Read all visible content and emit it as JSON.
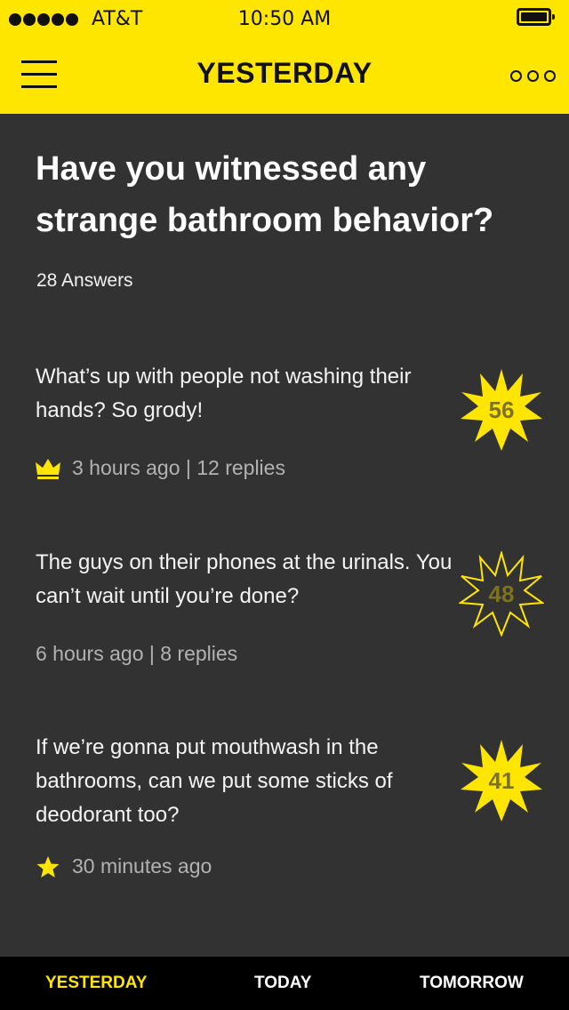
{
  "status_bar": {
    "carrier": "AT&T",
    "time": "10:50 AM",
    "signal_bars": 5,
    "battery_icon": "battery-full-icon"
  },
  "nav": {
    "title": "YESTERDAY",
    "menu_icon": "hamburger-menu-icon",
    "more_icon": "more-options-icon"
  },
  "question": {
    "title": "Have you witnessed any strange bathroom behavior?",
    "answers_count": "28 Answers"
  },
  "answers": [
    {
      "text": "What’s up with people not washing their hands? So grody!",
      "meta": "3 hours ago | 12 replies",
      "badge_icon": "crown-icon",
      "score": "56",
      "score_style": "filled"
    },
    {
      "text": "The guys on their phones at the urinals. You can’t wait until you’re done?",
      "meta": "6 hours ago | 8 replies",
      "badge_icon": "",
      "score": "48",
      "score_style": "outline"
    },
    {
      "text": "If we’re gonna put mouthwash in the bathrooms, can we put some sticks of deodorant too?",
      "meta": "30 minutes ago",
      "badge_icon": "star-icon",
      "score": "41",
      "score_style": "filled"
    }
  ],
  "tabs": [
    {
      "label": "YESTERDAY",
      "active": true
    },
    {
      "label": "TODAY",
      "active": false
    },
    {
      "label": "TOMORROW",
      "active": false
    }
  ],
  "colors": {
    "accent": "#ffe600",
    "background": "#323232",
    "tab_bar": "#000000",
    "meta_text": "#b2b2b2",
    "score_text": "#7d7220"
  }
}
